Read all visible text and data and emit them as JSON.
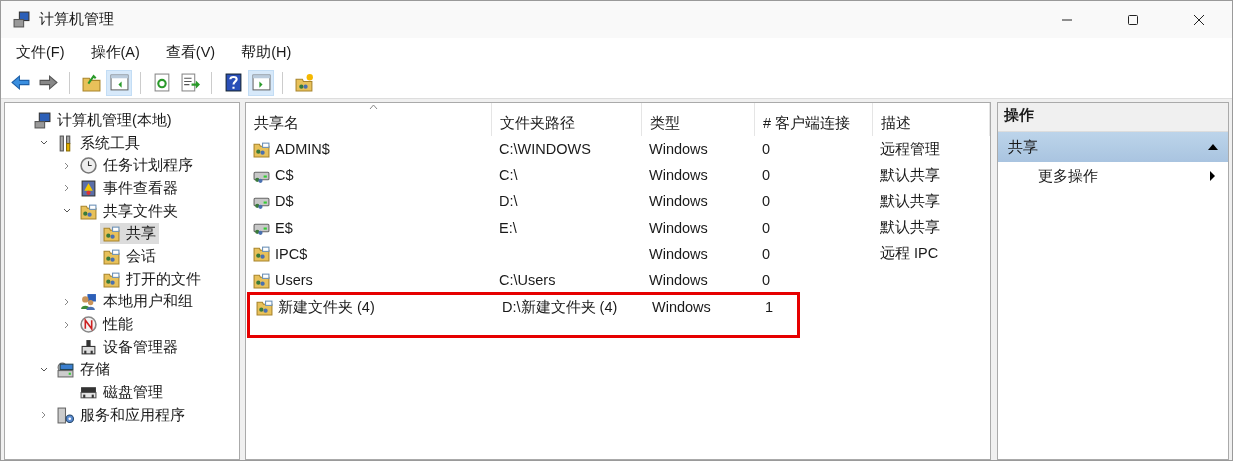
{
  "window": {
    "title": "计算机管理"
  },
  "menu": [
    "文件(F)",
    "操作(A)",
    "查看(V)",
    "帮助(H)"
  ],
  "toolbar_groups": [
    {
      "buttons": [
        {
          "selected": false
        },
        {
          "selected": false
        }
      ]
    },
    {
      "buttons": [
        {
          "selected": false
        },
        {
          "selected": true
        }
      ]
    },
    {
      "buttons": [
        {
          "selected": false
        },
        {
          "selected": false
        }
      ]
    },
    {
      "buttons": [
        {
          "selected": false
        },
        {
          "selected": true
        }
      ]
    },
    {
      "buttons": [
        {
          "selected": false
        }
      ]
    }
  ],
  "tree": [
    {
      "label": "计算机管理(本地)",
      "kind": "computer",
      "selected": false,
      "children": [
        {
          "label": "系统工具",
          "kind": "tools",
          "selected": false,
          "expanded": true,
          "children": [
            {
              "label": "任务计划程序",
              "kind": "clock",
              "selected": false,
              "expanded": false
            },
            {
              "label": "事件查看器",
              "kind": "log",
              "selected": false,
              "expanded": false
            },
            {
              "label": "共享文件夹",
              "kind": "share",
              "selected": false,
              "expanded": true,
              "children": [
                {
                  "label": "共享",
                  "kind": "share",
                  "selected": true
                },
                {
                  "label": "会话",
                  "kind": "share",
                  "selected": false
                },
                {
                  "label": "打开的文件",
                  "kind": "share",
                  "selected": false
                }
              ]
            },
            {
              "label": "本地用户和组",
              "kind": "users",
              "selected": false,
              "expanded": false
            },
            {
              "label": "性能",
              "kind": "gauge",
              "selected": false,
              "expanded": false
            },
            {
              "label": "设备管理器",
              "kind": "device",
              "selected": false
            }
          ]
        },
        {
          "label": "存储",
          "kind": "storage",
          "selected": false,
          "expanded": true,
          "children": [
            {
              "label": "磁盘管理",
              "kind": "disk",
              "selected": false
            }
          ]
        },
        {
          "label": "服务和应用程序",
          "kind": "services",
          "selected": false,
          "expanded": false
        }
      ]
    }
  ],
  "table": {
    "columns": [
      {
        "label": "共享名",
        "sorted": true
      },
      {
        "label": "文件夹路径",
        "sorted": false
      },
      {
        "label": "类型",
        "sorted": false
      },
      {
        "label": "# 客户端连接",
        "sorted": false
      },
      {
        "label": "描述",
        "sorted": false
      }
    ],
    "rows": [
      {
        "kind": "folder",
        "highlighted": false,
        "cells": [
          "ADMIN$",
          "C:\\WINDOWS",
          "Windows",
          "0",
          "远程管理"
        ]
      },
      {
        "kind": "drive",
        "highlighted": false,
        "cells": [
          "C$",
          "C:\\",
          "Windows",
          "0",
          "默认共享"
        ]
      },
      {
        "kind": "drive",
        "highlighted": false,
        "cells": [
          "D$",
          "D:\\",
          "Windows",
          "0",
          "默认共享"
        ]
      },
      {
        "kind": "drive",
        "highlighted": false,
        "cells": [
          "E$",
          "E:\\",
          "Windows",
          "0",
          "默认共享"
        ]
      },
      {
        "kind": "folder",
        "highlighted": false,
        "cells": [
          "IPC$",
          "",
          "Windows",
          "0",
          "远程 IPC"
        ]
      },
      {
        "kind": "folder",
        "highlighted": false,
        "cells": [
          "Users",
          "C:\\Users",
          "Windows",
          "0",
          ""
        ]
      },
      {
        "kind": "folder",
        "highlighted": true,
        "cells": [
          "新建文件夹 (4)",
          "D:\\新建文件夹 (4)",
          "Windows",
          "1",
          ""
        ]
      }
    ]
  },
  "actions": {
    "title": "操作",
    "sections": [
      {
        "label": "共享",
        "expanded": true,
        "items": [
          {
            "label": "更多操作"
          }
        ]
      }
    ]
  }
}
